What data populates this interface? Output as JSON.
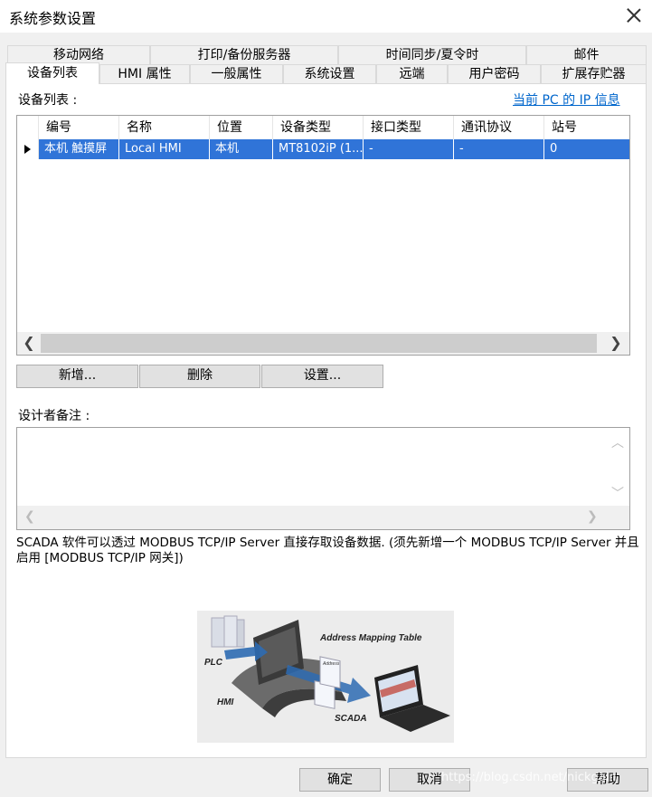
{
  "window": {
    "title": "系统参数设置"
  },
  "tabs_row1": [
    "移动网络",
    "打印/备份服务器",
    "时间同步/夏令时",
    "邮件"
  ],
  "tabs_row2": [
    "设备列表",
    "HMI 属性",
    "一般属性",
    "系统设置",
    "远端",
    "用户密码",
    "扩展存贮器"
  ],
  "device_list": {
    "label": "设备列表 :",
    "ip_link": "当前 PC 的 IP 信息",
    "columns": [
      "编号",
      "名称",
      "位置",
      "设备类型",
      "接口类型",
      "通讯协议",
      "站号"
    ],
    "rows": [
      [
        "本机 触摸屏",
        "Local HMI",
        "本机",
        "MT8102iP (1...",
        "-",
        "-",
        "0"
      ]
    ]
  },
  "buttons": {
    "add": "新增...",
    "delete": "删除",
    "settings": "设置..."
  },
  "memo": {
    "label": "设计者备注 :",
    "value": ""
  },
  "note": "SCADA 软件可以透过 MODBUS TCP/IP Server 直接存取设备数据. (须先新增一个 MODBUS TCP/IP Server 并且启用 [MODBUS TCP/IP 网关])",
  "illustration": {
    "title": "Address Mapping Table",
    "plc": "PLC",
    "hmi": "HMI",
    "scada": "SCADA",
    "address": "Address"
  },
  "footer": {
    "ok": "确定",
    "cancel": "取消",
    "help": "帮助"
  },
  "watermark": "https://blog.csdn.net/nickgain"
}
